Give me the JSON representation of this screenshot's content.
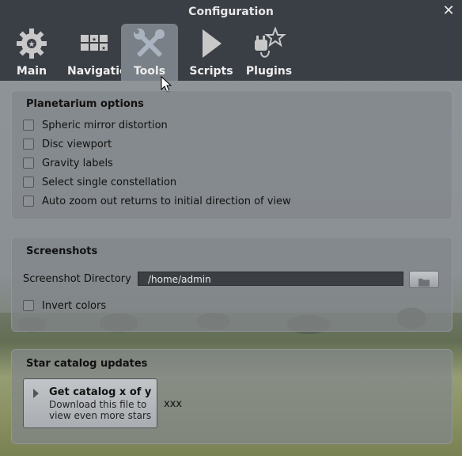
{
  "window": {
    "title": "Configuration",
    "close_icon": "close-icon"
  },
  "tabs": [
    {
      "label": "Main",
      "icon": "gear-icon"
    },
    {
      "label": "Navigation",
      "icon": "navigation-keys-icon"
    },
    {
      "label": "Tools",
      "icon": "tools-icon",
      "active": true
    },
    {
      "label": "Scripts",
      "icon": "play-icon"
    },
    {
      "label": "Plugins",
      "icon": "plugin-icon"
    }
  ],
  "planetarium": {
    "title": "Planetarium options",
    "options": [
      {
        "label": "Spheric mirror distortion",
        "checked": false
      },
      {
        "label": "Disc viewport",
        "checked": false
      },
      {
        "label": "Gravity labels",
        "checked": false
      },
      {
        "label": "Select single constellation",
        "checked": false
      },
      {
        "label": "Auto zoom out returns to initial direction of view",
        "checked": false
      }
    ]
  },
  "screenshots": {
    "title": "Screenshots",
    "dir_label": "Screenshot Directory",
    "dir_value": "/home/admin",
    "browse_icon": "folder-icon",
    "invert_label": "Invert colors",
    "invert_checked": false
  },
  "catalog": {
    "title": "Star catalog updates",
    "button_title": "Get catalog x of y",
    "button_desc": "Download this file to view even more stars",
    "status": "xxx"
  }
}
